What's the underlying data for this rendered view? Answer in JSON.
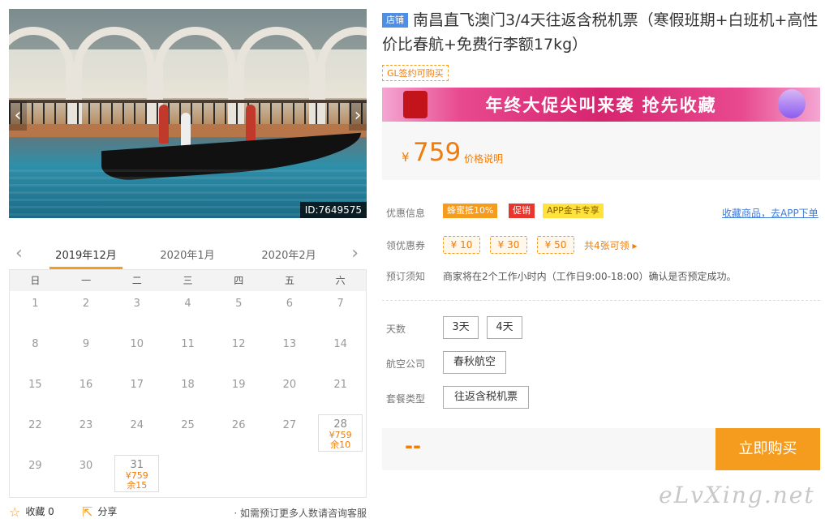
{
  "photo": {
    "id_label": "ID:7649575",
    "prev_icon": "chevron-left-icon",
    "next_icon": "chevron-right-icon"
  },
  "calendar": {
    "months": [
      "2019年12月",
      "2020年1月",
      "2020年2月"
    ],
    "active_month": "2019年12月",
    "weekdays": [
      "日",
      "一",
      "二",
      "三",
      "四",
      "五",
      "六"
    ],
    "days": [
      {
        "day": "1"
      },
      {
        "day": "2"
      },
      {
        "day": "3"
      },
      {
        "day": "4"
      },
      {
        "day": "5"
      },
      {
        "day": "6"
      },
      {
        "day": "7"
      },
      {
        "day": "8"
      },
      {
        "day": "9"
      },
      {
        "day": "10"
      },
      {
        "day": "11"
      },
      {
        "day": "12"
      },
      {
        "day": "13"
      },
      {
        "day": "14"
      },
      {
        "day": "15"
      },
      {
        "day": "16"
      },
      {
        "day": "17"
      },
      {
        "day": "18"
      },
      {
        "day": "19"
      },
      {
        "day": "20"
      },
      {
        "day": "21"
      },
      {
        "day": "22"
      },
      {
        "day": "23"
      },
      {
        "day": "24"
      },
      {
        "day": "25"
      },
      {
        "day": "26"
      },
      {
        "day": "27"
      },
      {
        "day": "28",
        "price": "¥759",
        "remain": "余10"
      },
      {
        "day": "29"
      },
      {
        "day": "30"
      },
      {
        "day": "31",
        "price": "¥759",
        "remain": "余15"
      }
    ]
  },
  "left_footer": {
    "favorite_label": "收藏 0",
    "share_label": "分享",
    "note": "· 如需预订更多人数请咨询客服"
  },
  "title": {
    "tag": "店铺",
    "text": "南昌直飞澳门3/4天往返含税机票（寒假班期+白班机+高性价比春航+免费行李额17kg）",
    "badge": "GL签约可购买"
  },
  "banner": {
    "text": "年终大促尖叫来袭  抢先收藏"
  },
  "price": {
    "currency": "¥",
    "value": "759",
    "explain": "价格说明"
  },
  "promo": {
    "label": "优惠信息",
    "chips": [
      "蜂蜜抵10%",
      "促销",
      "APP金卡专享"
    ],
    "fav_link": "收藏商品，去APP下单"
  },
  "coupons": {
    "label": "领优惠券",
    "items": [
      "¥ 10",
      "¥ 30",
      "¥ 50"
    ],
    "more": "共4张可领 ▸"
  },
  "notice": {
    "label": "预订须知",
    "text": "商家将在2个工作小时内（工作日9:00-18:00）确认是否预定成功。"
  },
  "options": {
    "days": {
      "label": "天数",
      "values": [
        "3天",
        "4天"
      ]
    },
    "airline": {
      "label": "航空公司",
      "values": [
        "春秋航空"
      ]
    },
    "package": {
      "label": "套餐类型",
      "values": [
        "往返含税机票"
      ]
    }
  },
  "buy": {
    "total": "--",
    "button": "立即购买"
  },
  "watermark": "eLvXing.net",
  "colors": {
    "accent": "#f59b1e",
    "price": "#f07c0b",
    "link": "#3f7bd8",
    "promo_red": "#e8352d"
  }
}
